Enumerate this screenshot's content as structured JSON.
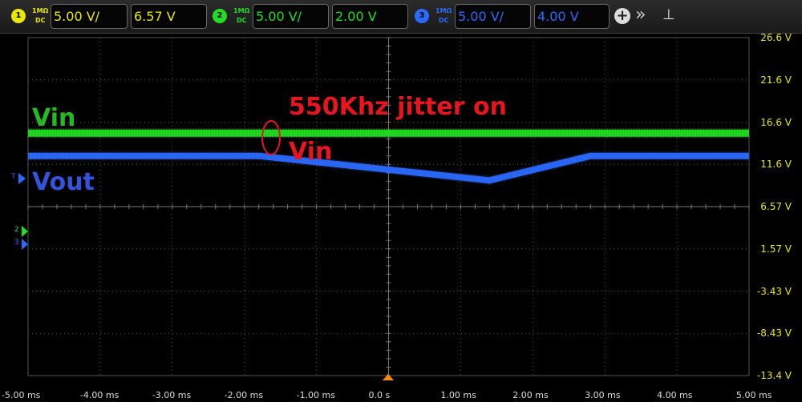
{
  "channels": [
    {
      "num": "1",
      "impedance": "1MΩ",
      "coupling": "DC",
      "scale": "5.00 V/",
      "offset": "6.57 V",
      "color": "#e8e800"
    },
    {
      "num": "2",
      "impedance": "1MΩ",
      "coupling": "DC",
      "scale": "5.00 V/",
      "offset": "2.00 V",
      "color": "#22dd22"
    },
    {
      "num": "3",
      "impedance": "1MΩ",
      "coupling": "DC",
      "scale": "5.00 V/",
      "offset": "4.00 V",
      "color": "#2a6bff"
    }
  ],
  "toolbar": {
    "add_label": "+",
    "more_label": "»",
    "pin_label": "⊥"
  },
  "y_axis": [
    "26.6 V",
    "21.6 V",
    "16.6 V",
    "11.6 V",
    "6.57 V",
    "1.57 V",
    "-3.43 V",
    "-8.43 V",
    "-13.4 V"
  ],
  "x_axis": [
    "-5.00 ms",
    "-4.00 ms",
    "-3.00 ms",
    "-2.00 ms",
    "-1.00 ms",
    "0.0 s",
    "1.00 ms",
    "2.00 ms",
    "3.00 ms",
    "4.00 ms",
    "5.00 ms"
  ],
  "annotations": {
    "vin": "Vin",
    "vout": "Vout",
    "jitter_line1": "550Khz jitter on",
    "jitter_line2": "Vin"
  },
  "markers": {
    "trigger_level": "T",
    "ch2_ground": "2",
    "ch3_ground": "3"
  },
  "chart_data": {
    "type": "line",
    "xlabel": "",
    "ylabel": "",
    "xlim": [
      -5,
      5
    ],
    "ylim": [
      -13.4,
      26.6
    ],
    "series": [
      {
        "name": "Vin",
        "color": "#22dd22",
        "x": [
          -5,
          5
        ],
        "y": [
          15.3,
          15.3
        ]
      },
      {
        "name": "Vout",
        "color": "#2a6bff",
        "x": [
          -5,
          -1.8,
          1.4,
          2.8,
          5
        ],
        "y": [
          12.6,
          12.6,
          9.7,
          12.6,
          12.6
        ]
      }
    ]
  }
}
